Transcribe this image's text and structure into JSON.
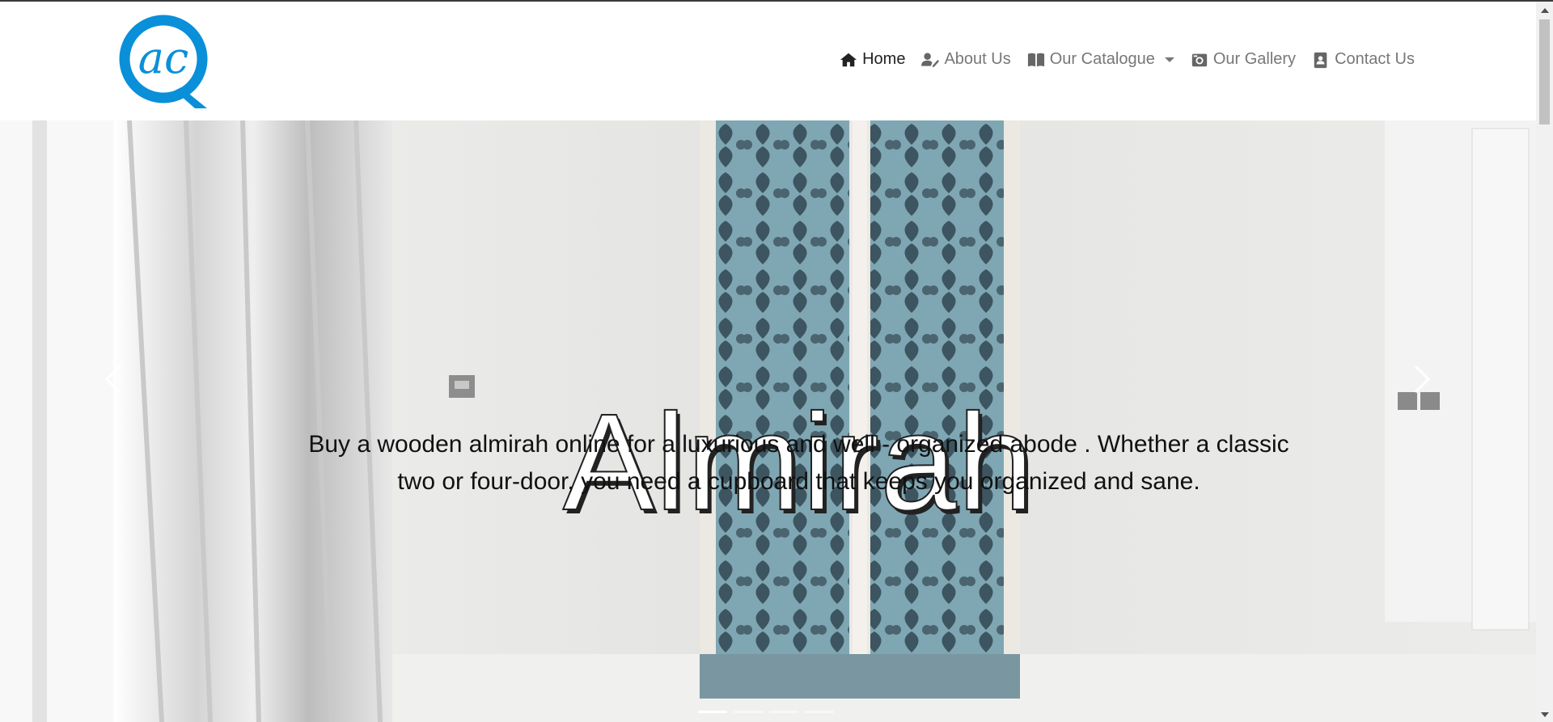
{
  "nav": {
    "items": [
      {
        "label": "Home",
        "icon": "home-icon"
      },
      {
        "label": "About Us",
        "icon": "user-edit-icon"
      },
      {
        "label": "Our Catalogue",
        "icon": "book-open-icon"
      },
      {
        "label": "Our Gallery",
        "icon": "camera-icon"
      },
      {
        "label": "Contact Us",
        "icon": "address-book-icon"
      }
    ]
  },
  "brand": {
    "logo_text": "ac",
    "logo_letter": "Q",
    "logo_color": "#0a8fd9"
  },
  "hero": {
    "title": "Almirah",
    "text": "Buy a wooden almirah online for a luxurious and well - organized abode . Whether a classic two or four-door, you need a cupboard that keeps you organized and sane.",
    "active_slide": 1,
    "slide_count": 4
  },
  "colors": {
    "nav_text": "#777777",
    "nav_active": "#222222"
  }
}
